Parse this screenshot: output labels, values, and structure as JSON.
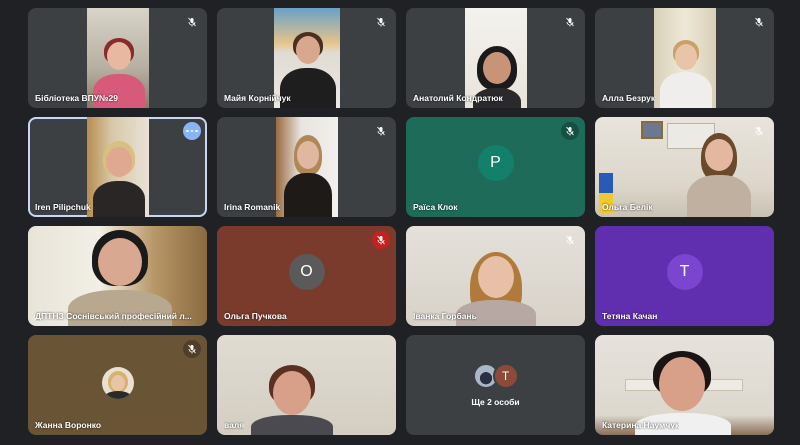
{
  "meeting": {
    "participants": [
      {
        "name": "Бібліотека ВПУ№29",
        "mic": "muted"
      },
      {
        "name": "Майя Корнійчук",
        "mic": "muted"
      },
      {
        "name": "Анатолий Кондратюк",
        "mic": "muted"
      },
      {
        "name": "Алла Безрук",
        "mic": "muted"
      },
      {
        "name": "Iren Pilipchuk",
        "mic": "more-options"
      },
      {
        "name": "Irina Romanik",
        "mic": "muted"
      },
      {
        "name": "Раїса Клок",
        "mic": "muted",
        "initial": "P"
      },
      {
        "name": "Ольга Белік",
        "mic": "muted"
      },
      {
        "name": "ДПТНЗ Соснівський професійний л...",
        "mic": "none"
      },
      {
        "name": "Ольга Пучкова",
        "mic": "muted",
        "initial": "O"
      },
      {
        "name": "Іванка Горбань",
        "mic": "muted"
      },
      {
        "name": "Тетяна Качан",
        "mic": "none",
        "initial": "T"
      },
      {
        "name": "Жанна Воронко",
        "mic": "muted"
      },
      {
        "name": "валя",
        "mic": "none"
      },
      {
        "name": "Ще 2 особи",
        "mic": "none",
        "initial": "T"
      },
      {
        "name": "Катерина Наумчук",
        "mic": "none"
      }
    ]
  },
  "colors": {
    "tile_bg": "#3c4043",
    "raisa_bg": "#1e6b5a",
    "raisa_avatar": "#12806a",
    "olga_p_bg": "#7a3a2c",
    "olga_p_avatar": "#5a5a5a",
    "tetiana_bg": "#5f2fb0",
    "tetiana_avatar": "#7b45cf",
    "others_avatar": "#8d4a3a",
    "mic_muted_red": "#c5221f"
  },
  "icons": {
    "mic": "mic-off-icon",
    "more": "more-horizontal-icon"
  }
}
